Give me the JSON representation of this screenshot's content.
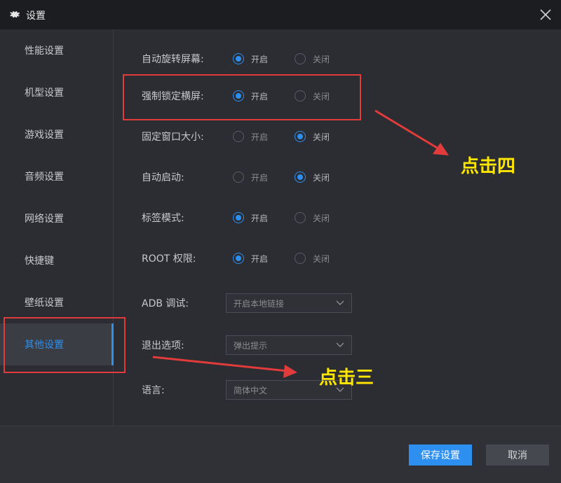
{
  "window": {
    "title": "设置"
  },
  "sidebar": {
    "items": [
      {
        "label": "性能设置",
        "active": false
      },
      {
        "label": "机型设置",
        "active": false
      },
      {
        "label": "游戏设置",
        "active": false
      },
      {
        "label": "音频设置",
        "active": false
      },
      {
        "label": "网络设置",
        "active": false
      },
      {
        "label": "快捷键",
        "active": false
      },
      {
        "label": "壁纸设置",
        "active": false
      },
      {
        "label": "其他设置",
        "active": true
      }
    ]
  },
  "settings": {
    "radio_rows": [
      {
        "label": "自动旋转屏幕:",
        "on": "开启",
        "off": "关闭",
        "selected": "on"
      },
      {
        "label": "强制锁定横屏:",
        "on": "开启",
        "off": "关闭",
        "selected": "on"
      },
      {
        "label": "固定窗口大小:",
        "on": "开启",
        "off": "关闭",
        "selected": "off"
      },
      {
        "label": "自动启动:",
        "on": "开启",
        "off": "关闭",
        "selected": "off"
      },
      {
        "label": "标签模式:",
        "on": "开启",
        "off": "关闭",
        "selected": "on"
      },
      {
        "label": "ROOT 权限:",
        "on": "开启",
        "off": "关闭",
        "selected": "on"
      }
    ],
    "select_rows": [
      {
        "label": "ADB 调试:",
        "value": "开启本地链接"
      },
      {
        "label": "退出选项:",
        "value": "弹出提示"
      },
      {
        "label": "语言:",
        "value": "简体中文"
      }
    ]
  },
  "footer": {
    "save_label": "保存设置",
    "cancel_label": "取消"
  },
  "annotations": {
    "step_four": "点击四",
    "step_three": "点击三"
  },
  "colors": {
    "accent": "#2d8ff0",
    "annotation_red": "#e23b3b",
    "annotation_yellow": "#ffe600"
  }
}
